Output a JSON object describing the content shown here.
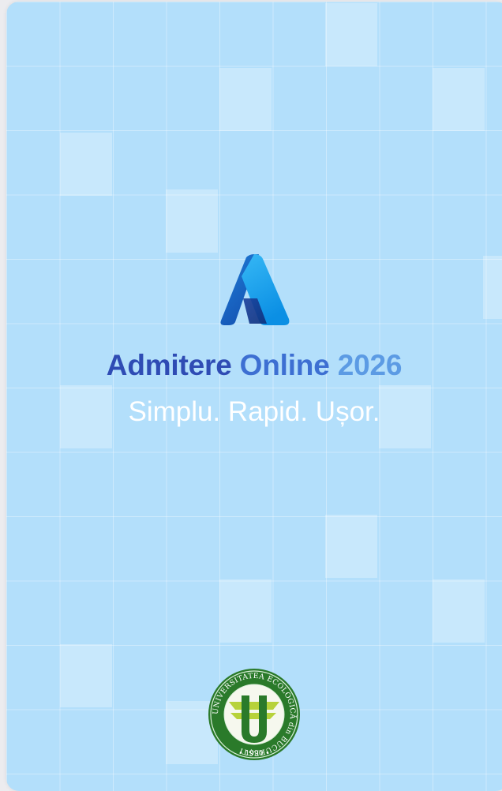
{
  "app": {
    "headline_word1": "Admitere",
    "headline_word2": "Online",
    "headline_word3": "2026",
    "tagline": "Simplu. Rapid. Ușor."
  },
  "colors": {
    "background": "#b3dffb",
    "headline_dark": "#2f4cb4",
    "headline_mid": "#3d6fd2",
    "headline_light": "#5c9be4",
    "seal_green": "#2a7a2a"
  },
  "icons": {
    "app_logo": "azure-a-logo-icon",
    "university_seal": "university-seal-icon"
  },
  "seal": {
    "ring_text": "UNIVERSITATEA ECOLOGICĂ din BUCUREȘTI",
    "year": "• 1990 •"
  }
}
